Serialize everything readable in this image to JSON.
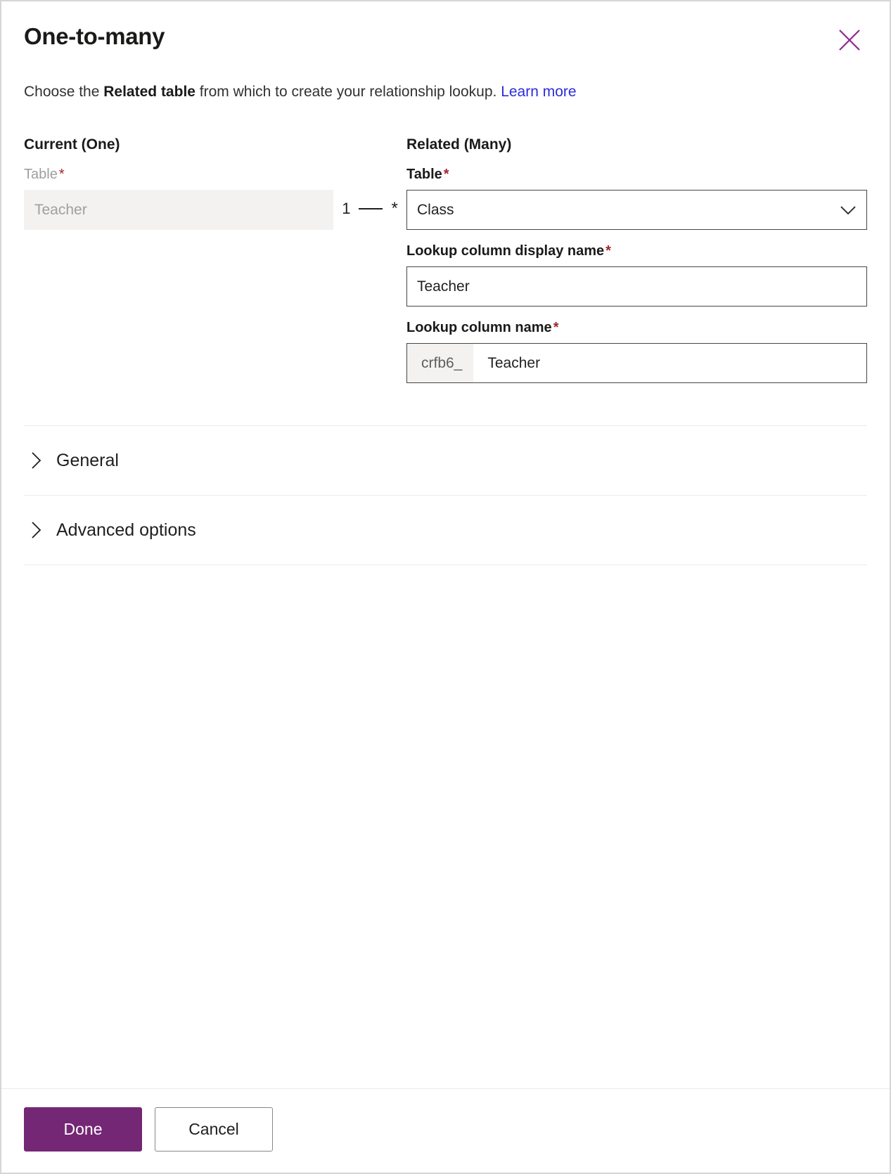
{
  "dialog": {
    "title": "One-to-many",
    "close_icon": "close-icon",
    "description": {
      "prefix": "Choose the ",
      "bold": "Related table",
      "suffix": " from which to create your relationship lookup. ",
      "link_label": "Learn more"
    }
  },
  "current": {
    "heading": "Current (One)",
    "table": {
      "label": "Table",
      "required_marker": "*",
      "value": "Teacher",
      "disabled": true
    }
  },
  "connector": {
    "left_cardinality": "1",
    "right_cardinality": "*"
  },
  "related": {
    "heading": "Related (Many)",
    "table": {
      "label": "Table",
      "required_marker": "*",
      "value": "Class",
      "chevron_icon": "chevron-down-icon"
    },
    "lookup_display_name": {
      "label": "Lookup column display name",
      "required_marker": "*",
      "value": "Teacher"
    },
    "lookup_name": {
      "label": "Lookup column name",
      "required_marker": "*",
      "prefix": "crfb6_",
      "value": "Teacher"
    }
  },
  "sections": [
    {
      "label": "General",
      "icon": "chevron-right-icon",
      "expanded": false
    },
    {
      "label": "Advanced options",
      "icon": "chevron-right-icon",
      "expanded": false
    }
  ],
  "footer": {
    "primary_label": "Done",
    "secondary_label": "Cancel"
  },
  "colors": {
    "accent": "#742774",
    "link": "#2b2bde",
    "required": "#a4262c",
    "disabled_bg": "#f3f2f1",
    "border": "#484644",
    "divider": "#edebe9"
  }
}
